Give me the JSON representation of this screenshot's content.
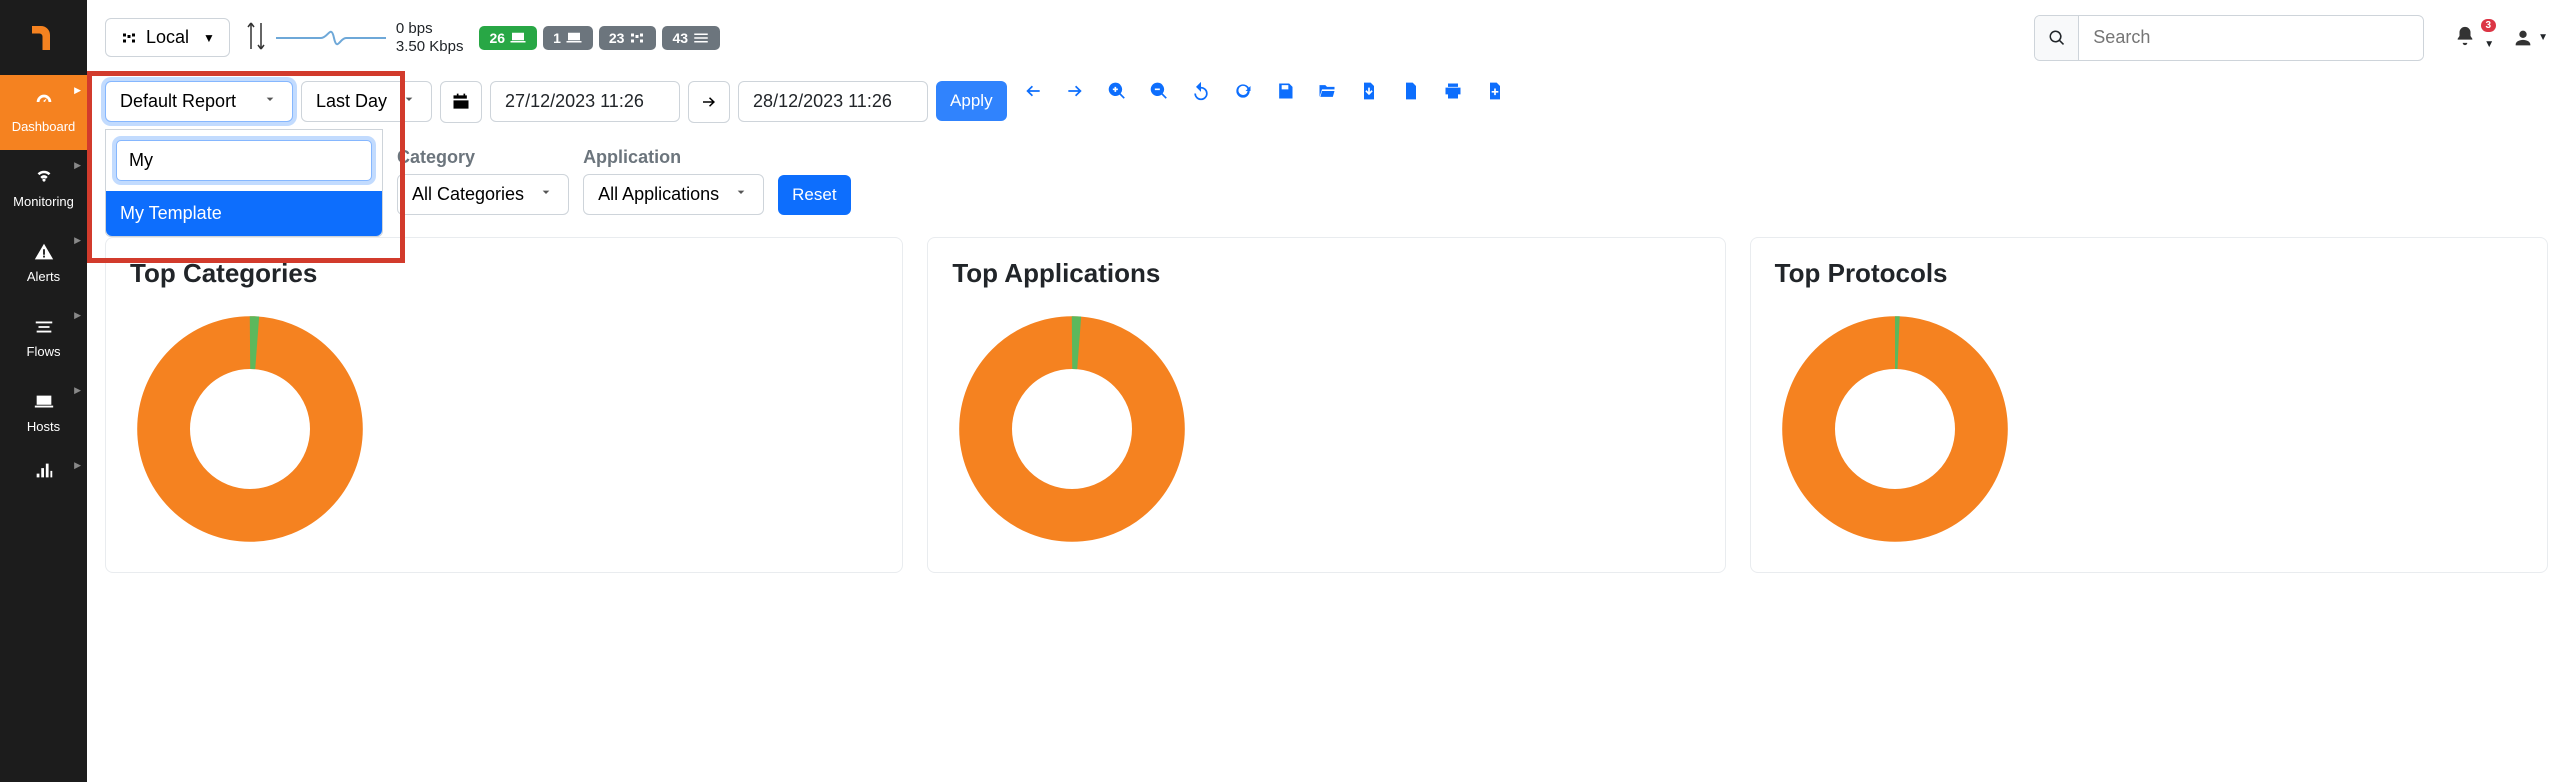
{
  "sidebar": {
    "items": [
      {
        "label": "Dashboard"
      },
      {
        "label": "Monitoring"
      },
      {
        "label": "Alerts"
      },
      {
        "label": "Flows"
      },
      {
        "label": "Hosts"
      }
    ]
  },
  "topbar": {
    "interface_label": "Local",
    "bps_up": "0 bps",
    "bps_down": "3.50 Kbps",
    "badges": {
      "devices": "26",
      "hosts": "1",
      "servers": "23",
      "flows": "43"
    },
    "search_placeholder": "Search",
    "notifications": "3"
  },
  "filters": {
    "report_label": "Default Report",
    "time_range_label": "Last Day",
    "date_from": "27/12/2023 11:26",
    "date_to": "28/12/2023 11:26",
    "apply_label": "Apply",
    "dropdown_search_value": "My",
    "dropdown_item": "My Template",
    "category_label": "Category",
    "category_value": "All Categories",
    "application_label": "Application",
    "application_value": "All Applications",
    "reset_label": "Reset"
  },
  "cards": [
    {
      "title": "Top Categories"
    },
    {
      "title": "Top Applications"
    },
    {
      "title": "Top Protocols"
    }
  ],
  "chart_data": [
    {
      "type": "pie",
      "title": "Top Categories",
      "slices": [
        {
          "color": "#f58220",
          "value": 97
        },
        {
          "color": "#5cb85c",
          "value": 3
        }
      ]
    },
    {
      "type": "pie",
      "title": "Top Applications",
      "slices": [
        {
          "color": "#f58220",
          "value": 97
        },
        {
          "color": "#5cb85c",
          "value": 3
        }
      ]
    },
    {
      "type": "pie",
      "title": "Top Protocols",
      "slices": [
        {
          "color": "#f58220",
          "value": 99
        },
        {
          "color": "#5cb85c",
          "value": 1
        }
      ]
    }
  ]
}
